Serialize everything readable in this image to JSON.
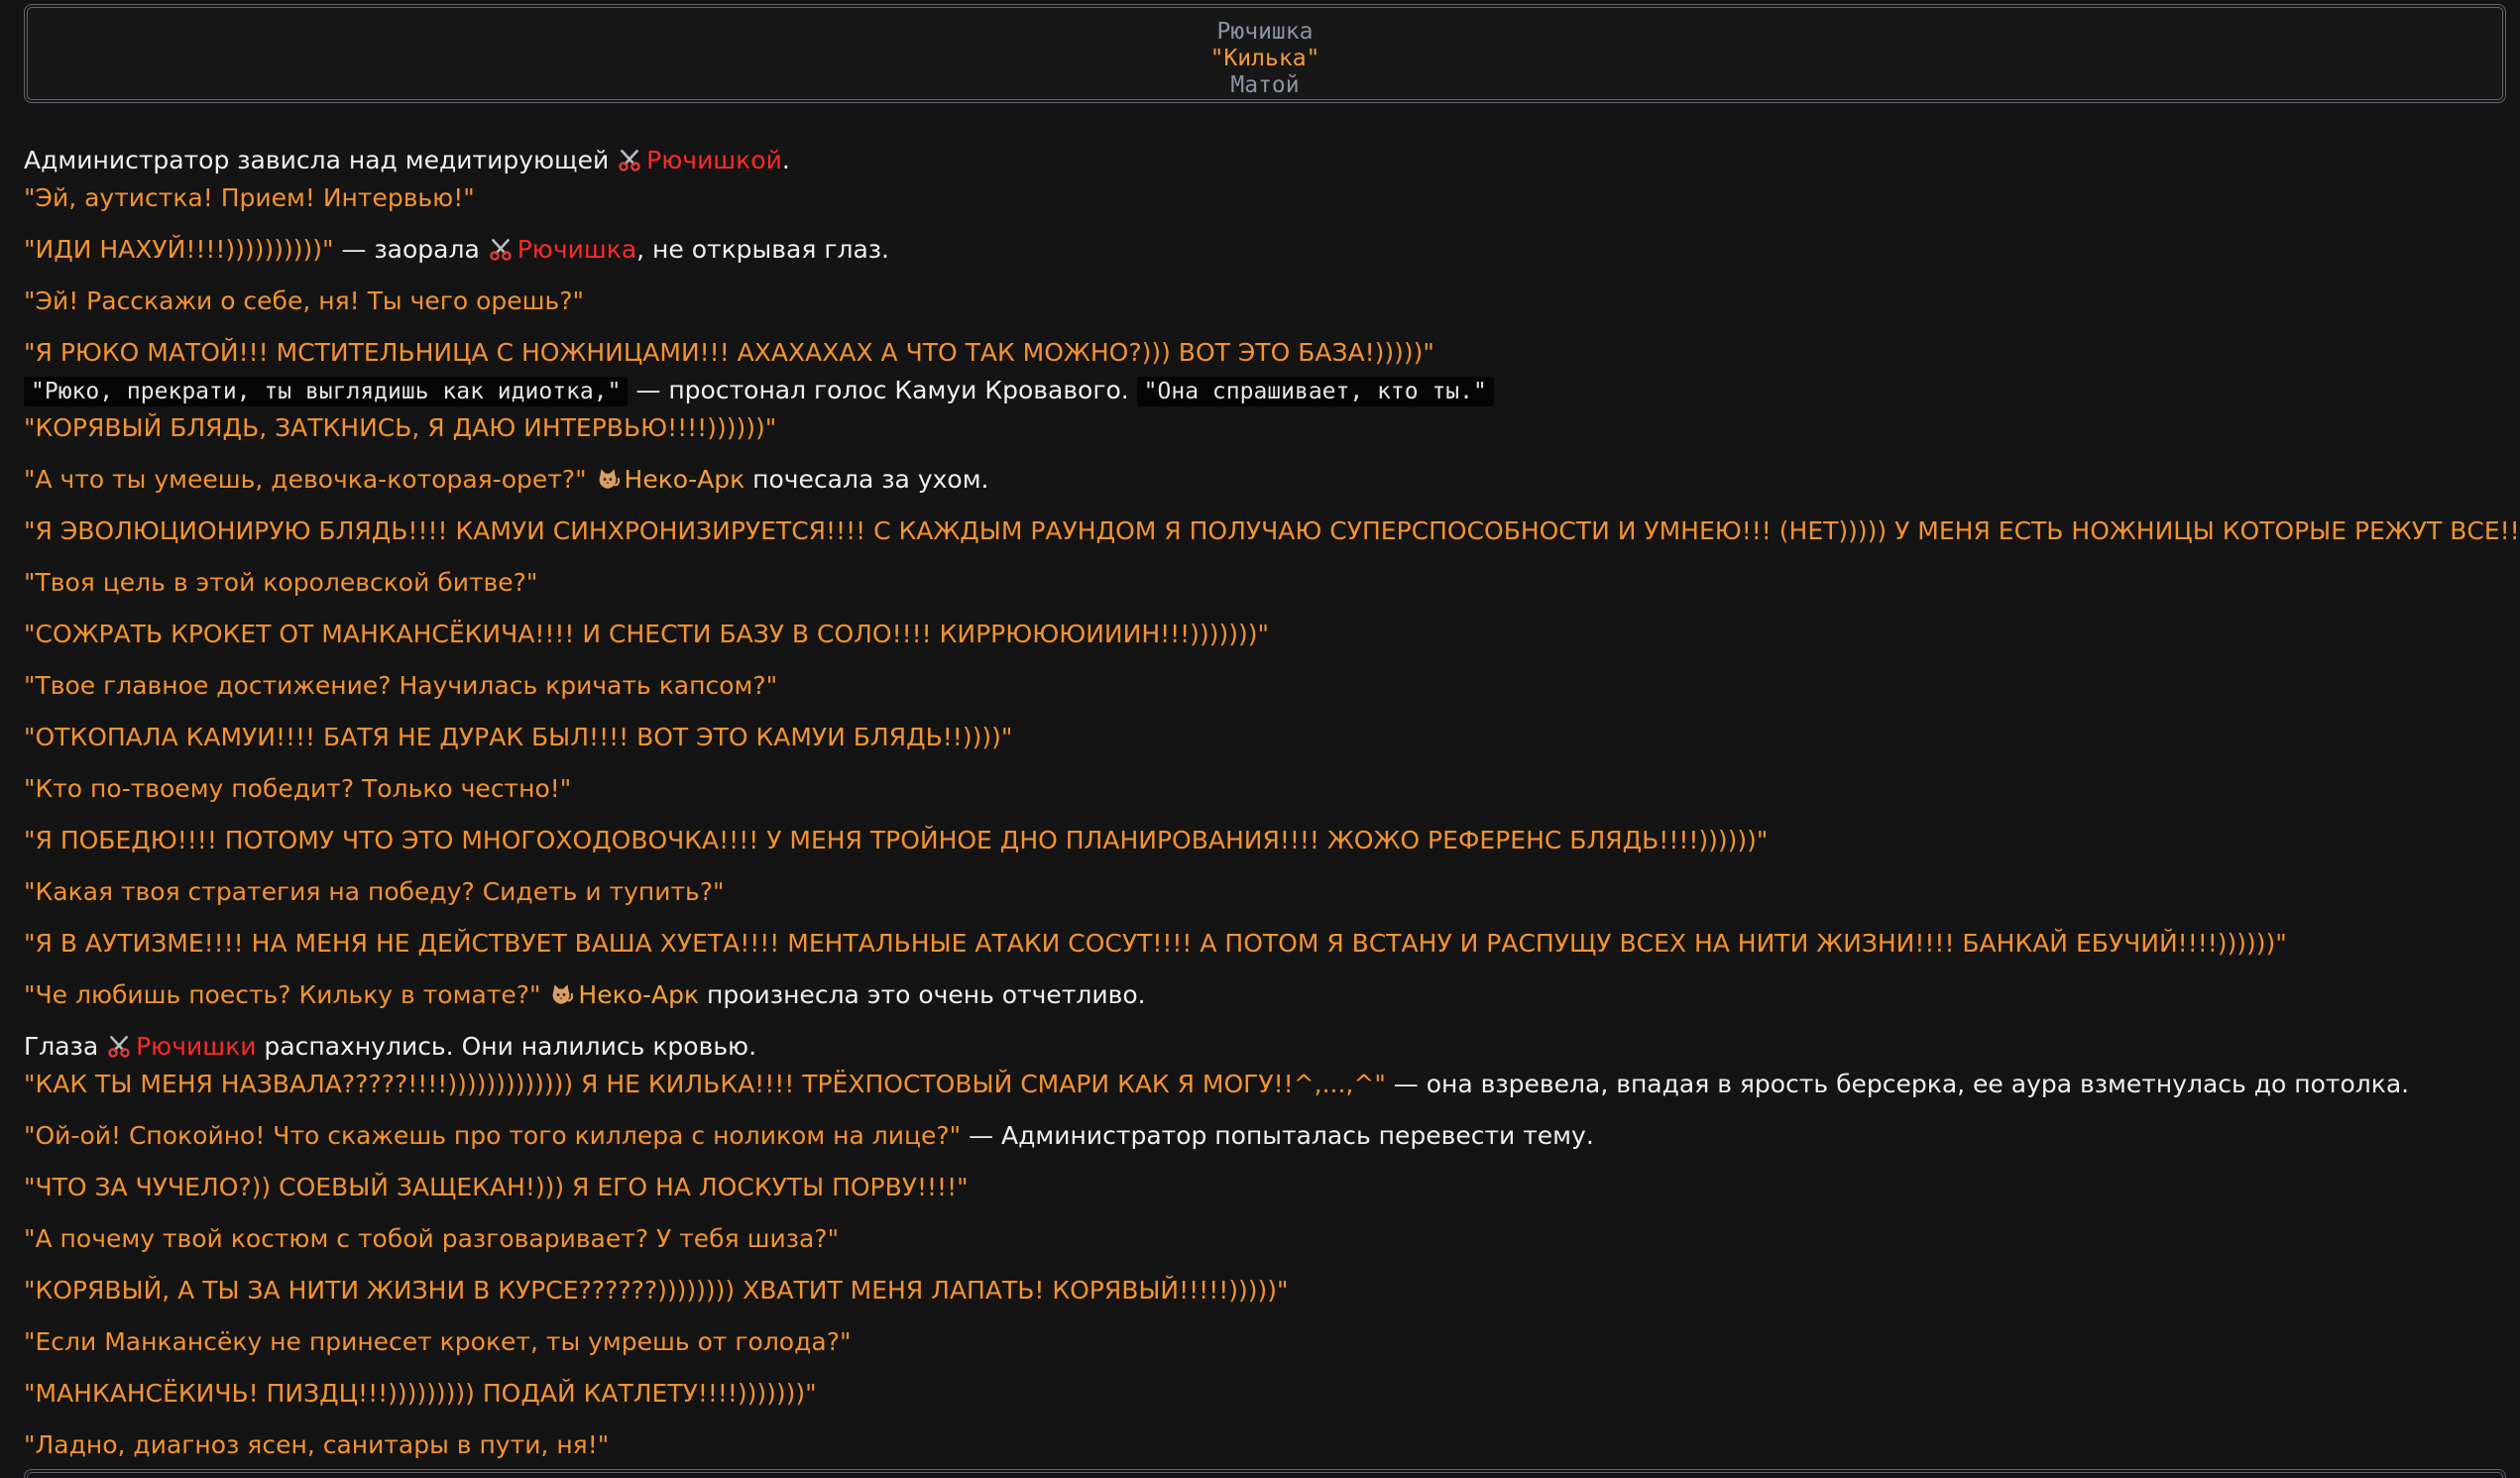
{
  "header": {
    "line1": "Рючишка",
    "line2": "\"Килька\"",
    "line3": "Матой"
  },
  "icons": {
    "scissors": "scissors-icon",
    "cat": "cat-icon"
  },
  "colors": {
    "orange": "#f4932f",
    "red": "#ff2a2a",
    "white": "#f0f0f0"
  },
  "story": {
    "l1": {
      "a": "Администратор зависла над медитирующей ",
      "b": "Рючишкой",
      "c": "."
    },
    "l2": "\"Эй, аутистка! Прием! Интервью!\"",
    "l3": {
      "a": "\"ИДИ НАХУЙ!!!!))))))))))\"",
      "b": " — заорала ",
      "c": "Рючишка",
      "d": ", не открывая глаз."
    },
    "l4": "\"Эй! Расскажи о себе, ня! Ты чего орешь?\"",
    "l5": "\"Я РЮКО МАТОЙ!!! МСТИТЕЛЬНИЦА С НОЖНИЦАМИ!!! АХАХАХАХ А ЧТО ТАК МОЖНО?))) ВОТ ЭТО БАЗА!)))))\"",
    "l6": {
      "a": "\"Рюко, прекрати, ты выглядишь как идиотка,\"",
      "b": " — простонал голос Камуи Кровавого. ",
      "c": "\"Она спрашивает, кто ты.\""
    },
    "l7": "\"КОРЯВЫЙ БЛЯДЬ, ЗАТКНИСЬ, Я ДАЮ ИНТЕРВЬЮ!!!!))))))\"",
    "l8": {
      "a": "\"А что ты умеешь, девочка-которая-орет?\" ",
      "b": "Неко-Арк",
      "c": " почесала за ухом."
    },
    "l9": "\"Я ЭВОЛЮЦИОНИРУЮ БЛЯДЬ!!!! КАМУИ СИНХРОНИЗИРУЕТСЯ!!!! С КАЖДЫМ РАУНДОМ Я ПОЛУЧАЮ СУПЕРСПОСОБНОСТИ И УМНЕЮ!!! (НЕТ))))) У МЕНЯ ЕСТЬ НОЖНИЦЫ КОТОРЫЕ РЕЖУТ ВСЕ!!!!\"",
    "l10": "\"Твоя цель в этой королевской битве?\"",
    "l11": "\"СОЖРАТЬ КРОКЕТ ОТ МАНКАНСЁКИЧА!!!! И СНЕСТИ БАЗУ В СОЛО!!!! КИРРЮЮЮИИИН!!!)))))))\"",
    "l12": "\"Твое главное достижение? Научилась кричать капсом?\"",
    "l13": "\"ОТКОПАЛА КАМУИ!!!! БАТЯ НЕ ДУРАК БЫЛ!!!! ВОТ ЭТО КАМУИ БЛЯДЬ!!))))\"",
    "l14": "\"Кто по-твоему победит? Только честно!\"",
    "l15": "\"Я ПОБЕДЮ!!!! ПОТОМУ ЧТО ЭТО МНОГОХОДОВОЧКА!!!! У МЕНЯ ТРОЙНОЕ ДНО ПЛАНИРОВАНИЯ!!!! ЖОЖО РЕФЕРЕНС БЛЯДЬ!!!!))))))\"",
    "l16": "\"Какая твоя стратегия на победу? Сидеть и тупить?\"",
    "l17": "\"Я В АУТИЗМЕ!!!! НА МЕНЯ НЕ ДЕЙСТВУЕТ ВАША ХУЕТА!!!! МЕНТАЛЬНЫЕ АТАКИ СОСУТ!!!! А ПОТОМ Я ВСТАНУ И РАСПУЩУ ВСЕХ НА НИТИ ЖИЗНИ!!!! БАНКАЙ ЕБУЧИЙ!!!!))))))\"",
    "l18": {
      "a": "\"Че любишь поесть? Кильку в томате?\" ",
      "b": "Неко-Арк",
      "c": " произнесла это очень отчетливо."
    },
    "l19": {
      "a": "Глаза ",
      "b": "Рючишки",
      "c": " распахнулись. Они налились кровью."
    },
    "l20": {
      "a": "\"КАК ТЫ МЕНЯ НАЗВАЛА?????!!!!))))))))))))) Я НЕ КИЛЬКА!!!! ТРЁХПОСТОВЫЙ СМАРИ КАК Я МОГУ!!^,...,^\"",
      "b": " — она взревела, впадая в ярость берсерка, ее аура взметнулась до потолка."
    },
    "l21": {
      "a": "\"Ой-ой! Спокойно! Что скажешь про того киллера с ноликом на лице?\"",
      "b": " — Администратор попыталась перевести тему."
    },
    "l22": "\"ЧТО ЗА ЧУЧЕЛО?)) СОЕВЫЙ ЗАЩЕКАН!))) Я ЕГО НА ЛОСКУТЫ ПОРВУ!!!!\"",
    "l23": "\"А почему твой костюм с тобой разговаривает? У тебя шиза?\"",
    "l24": "\"КОРЯВЫЙ, А ТЫ ЗА НИТИ ЖИЗНИ В КУРСЕ??????)))))))) ХВАТИТ МЕНЯ ЛАПАТЬ! КОРЯВЫЙ!!!!!)))))\"",
    "l25": "\"Если Манкансёку не принесет крокет, ты умрешь от голода?\"",
    "l26": "\"МАНКАНСЁКИЧЬ! ПИЗДЦ!!!))))))))) ПОДАЙ КАТЛЕТУ!!!!)))))))\"",
    "l27": "\"Ладно, диагноз ясен, санитары в пути, ня!\""
  }
}
